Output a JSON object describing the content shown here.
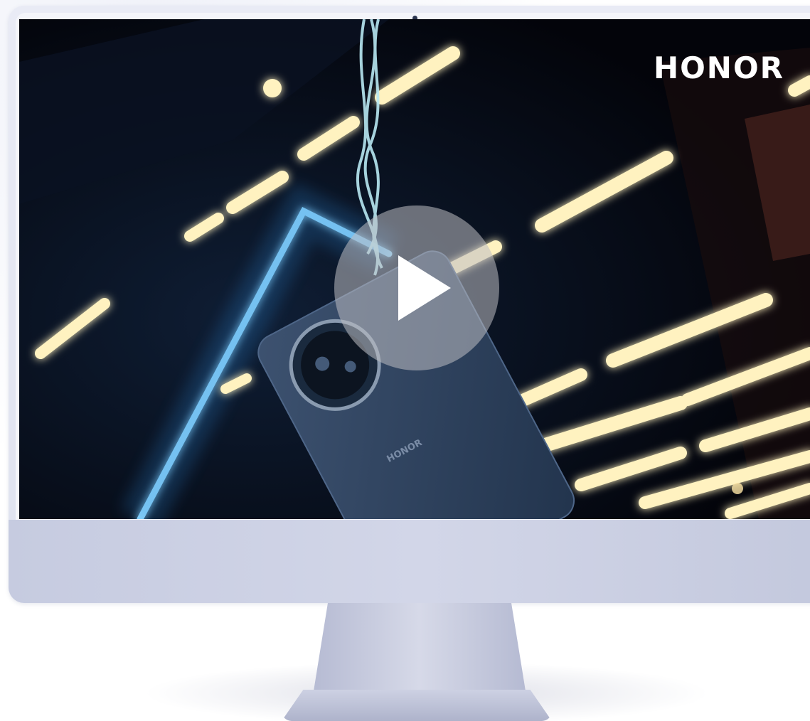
{
  "video": {
    "brand_logo": "HONOR",
    "phone_back_logo": "HONOR",
    "play_icon": "play-icon"
  },
  "colors": {
    "screen_bg": "#05060c",
    "neon": "#7fd0ff",
    "light_strip": "#fff3c4",
    "monitor_frame": "#dfe2ef",
    "monitor_chin": "#c9cee2"
  }
}
